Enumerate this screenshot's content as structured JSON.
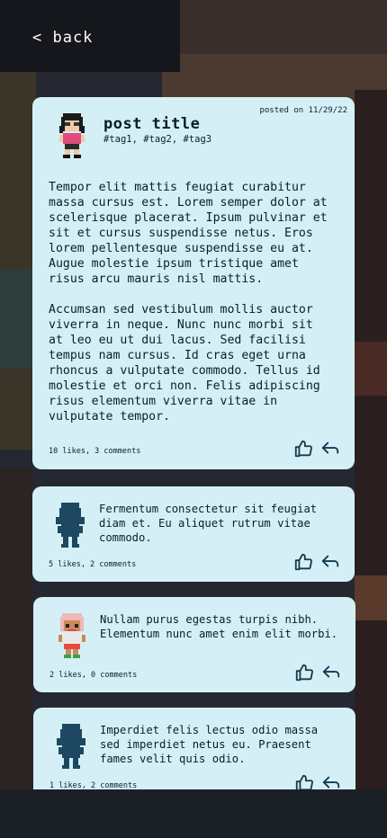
{
  "nav": {
    "back_label": "< back"
  },
  "post": {
    "title": "post title",
    "tags": "#tag1, #tag2, #tag3",
    "posted": "posted on 11/29/22",
    "body": "Tempor elit mattis feugiat curabitur\nmassa cursus est. Lorem semper dolor at\nscelerisque placerat. Ipsum pulvinar et\nsit et cursus suspendisse netus. Eros\nlorem pellentesque suspendisse eu at.\nAugue molestie ipsum tristique amet\nrisus arcu mauris nisl mattis.\n\nAccumsan sed vestibulum mollis auctor\nviverra in neque. Nunc nunc morbi sit\nat leo eu ut dui lacus. Sed facilisi\ntempus nam cursus. Id cras eget urna\nrhoncus a vulputate commodo. Tellus id\nmolestie et orci non. Felis adipiscing\nrisus elementum viverra vitae in\nvulputate tempor.",
    "meta": "10 likes, 3 comments",
    "like_icon": "thumbs-up-icon",
    "reply_icon": "reply-arrow-icon"
  },
  "comments": [
    {
      "avatar": "silhouette-avatar",
      "text": "Fermentum consectetur sit feugiat diam et. Eu aliquet rutrum vitae commodo.",
      "meta": "5 likes, 2 comments"
    },
    {
      "avatar": "pixel-girl-pink-hair-avatar",
      "text": "Nullam purus egestas turpis nibh. Elementum nunc amet enim elit morbi.",
      "meta": "2 likes, 0 comments"
    },
    {
      "avatar": "silhouette-avatar",
      "text": "Imperdiet felis lectus odio massa sed imperdiet netus eu. Praesent fames velit quis odio.",
      "meta": "1 likes, 2 comments"
    }
  ],
  "colors": {
    "card_bg": "#d4f0f6",
    "text": "#0c1c2c",
    "icon": "#143a52",
    "silhouette": "#1e4862"
  }
}
